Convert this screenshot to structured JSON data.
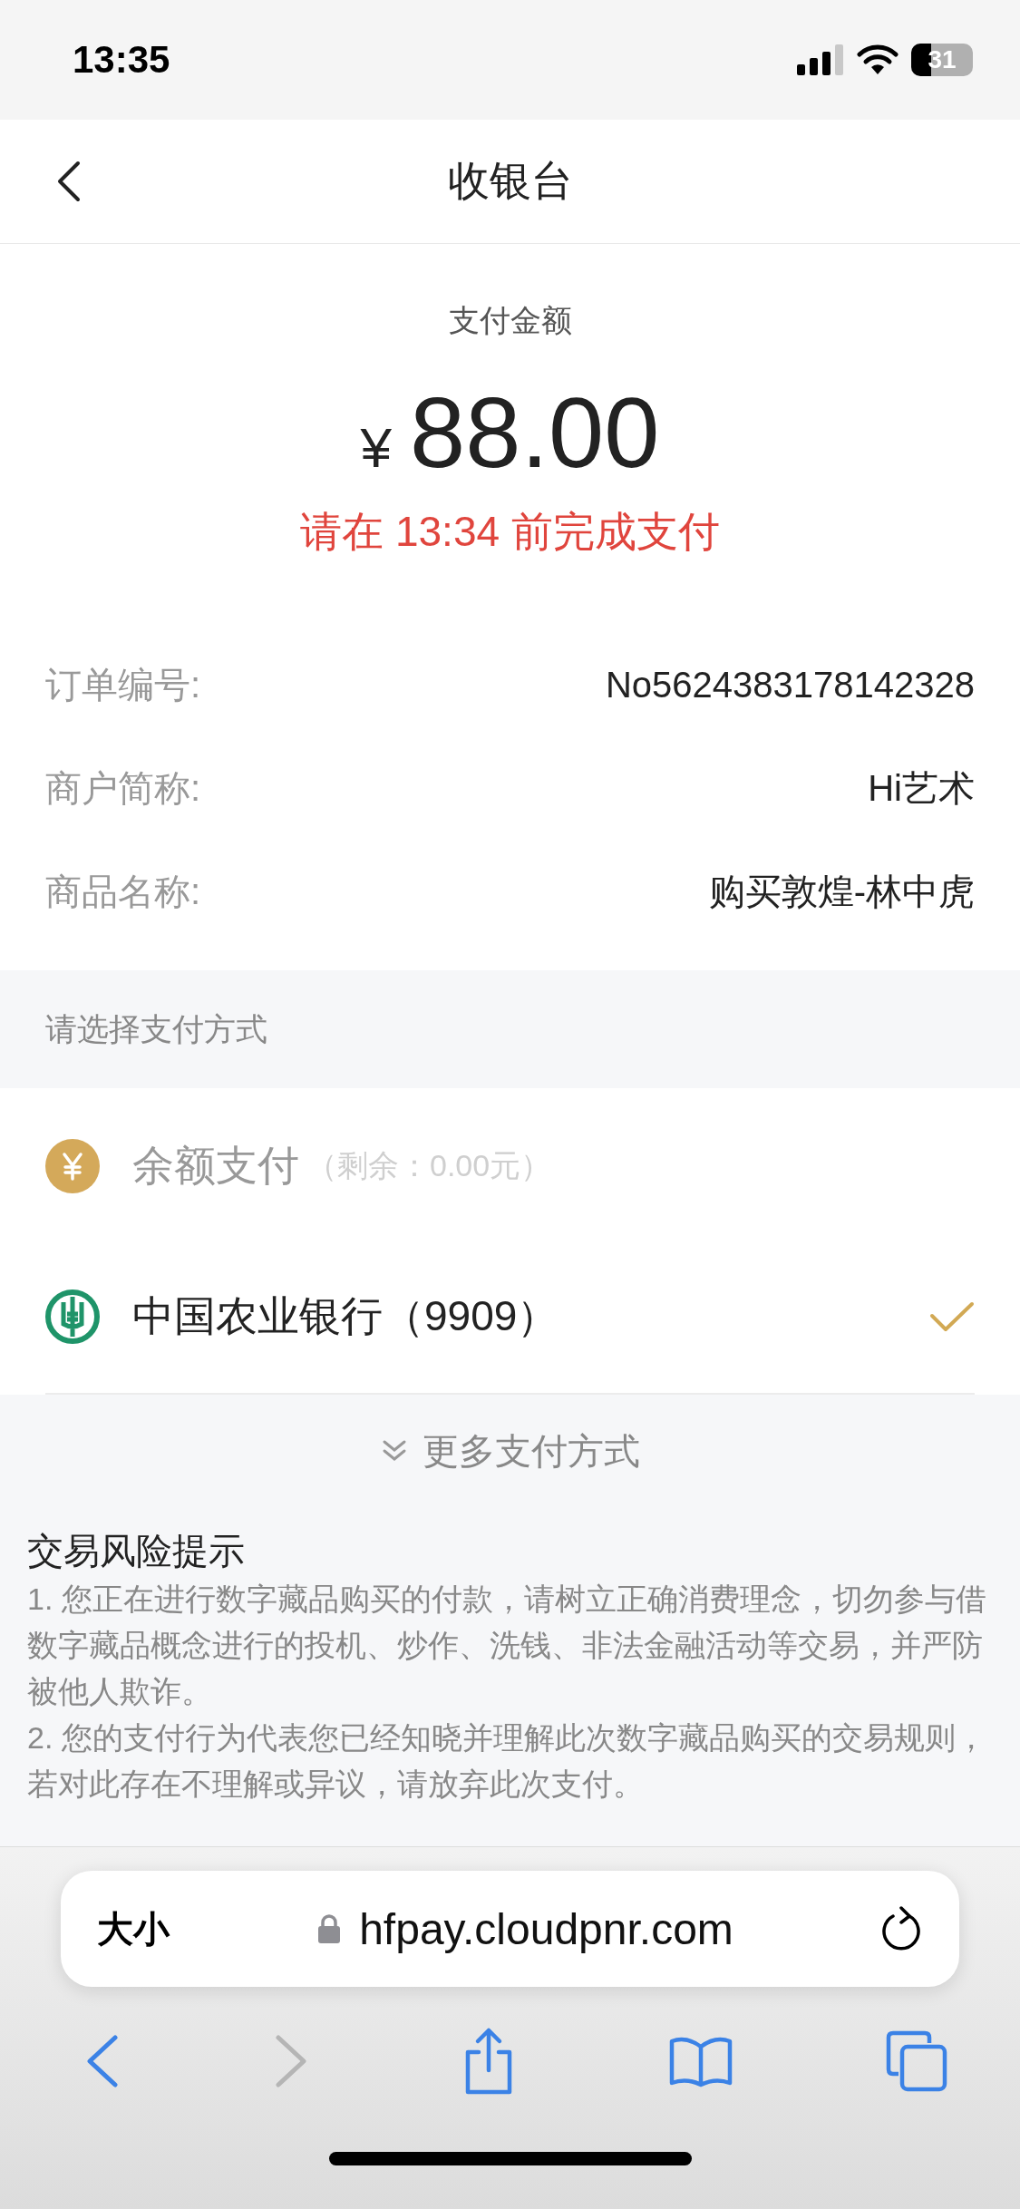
{
  "status_bar": {
    "time": "13:35",
    "battery": "31"
  },
  "nav": {
    "title": "收银台"
  },
  "amount": {
    "label": "支付金额",
    "currency": "¥",
    "value": "88.00",
    "deadline": "请在 13:34 前完成支付"
  },
  "order_info": [
    {
      "label": "订单编号:",
      "value": "No5624383178142328"
    },
    {
      "label": "商户简称:",
      "value": "Hi艺术"
    },
    {
      "label": "商品名称:",
      "value": "购买敦煌-林中虎"
    }
  ],
  "payment_section": {
    "title": "请选择支付方式"
  },
  "payment_methods": [
    {
      "kind": "balance",
      "name": "余额支付",
      "note": "（剩余：0.00元）",
      "disabled": true,
      "selected": false
    },
    {
      "kind": "bank",
      "name": "中国农业银行（9909）",
      "disabled": false,
      "selected": true
    }
  ],
  "more_methods": "更多支付方式",
  "risk_notice": {
    "title": "交易风险提示",
    "items": [
      "1. 您正在进行数字藏品购买的付款，请树立正确消费理念，切勿参与借数字藏品概念进行的投机、炒作、洗钱、非法金融活动等交易，并严防被他人欺诈。",
      "2. 您的支付行为代表您已经知晓并理解此次数字藏品购买的交易规则，若对此存在不理解或异议，请放弃此次支付。"
    ]
  },
  "browser": {
    "text_size": "大小",
    "url": "hfpay.cloudpnr.com",
    "toolbar": [
      {
        "kind": "back",
        "disabled": false
      },
      {
        "kind": "forward",
        "disabled": true
      },
      {
        "kind": "share",
        "disabled": false
      },
      {
        "kind": "bookmarks",
        "disabled": false
      },
      {
        "kind": "tabs",
        "disabled": false
      }
    ]
  }
}
